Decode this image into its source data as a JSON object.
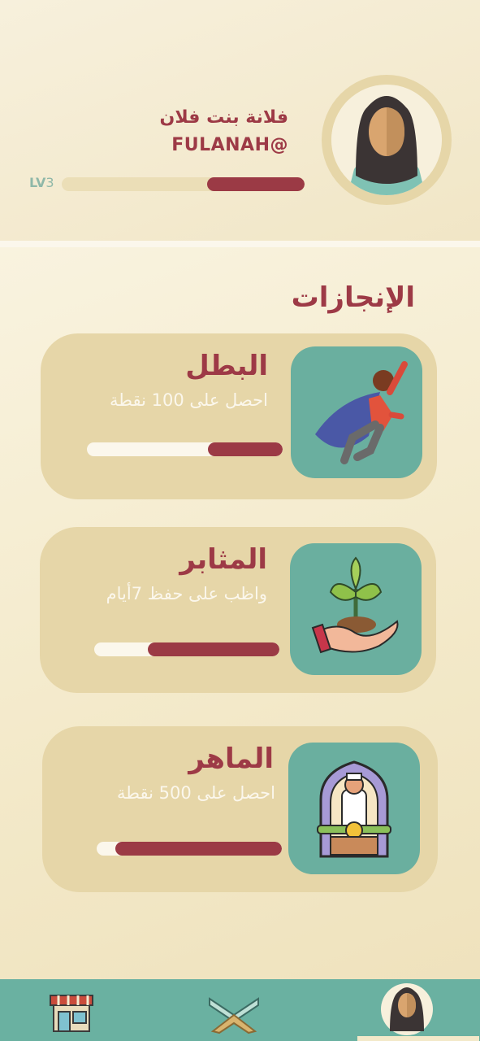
{
  "profile": {
    "name": "فلانة بنت فلان",
    "handle": "FULANAH@",
    "level_prefix": "LV",
    "level_number": "3",
    "level_progress": 0.4,
    "avatar_icon": "woman-hijab-avatar-icon"
  },
  "achievements": {
    "title": "الإنجازات",
    "items": [
      {
        "title": "البطل",
        "description": "احصل على 100 نقطة",
        "progress": 0.38,
        "icon": "superhero-icon"
      },
      {
        "title": "المثابر",
        "description": "واظب على حفظ 7أيام",
        "progress": 0.71,
        "icon": "plant-in-hand-icon"
      },
      {
        "title": "الماهر",
        "description": "احصل على 500 نقطة",
        "progress": 0.9,
        "icon": "quran-reader-icon"
      }
    ]
  },
  "nav": {
    "items": [
      {
        "name": "store",
        "icon": "store-icon",
        "active": false
      },
      {
        "name": "quran",
        "icon": "open-quran-icon",
        "active": false
      },
      {
        "name": "profile",
        "icon": "profile-avatar-icon",
        "active": true
      }
    ]
  },
  "colors": {
    "accent": "#9d3a46",
    "teal": "#6ab1a1",
    "card": "#e6d6a8",
    "background": "#f5ecd2"
  }
}
